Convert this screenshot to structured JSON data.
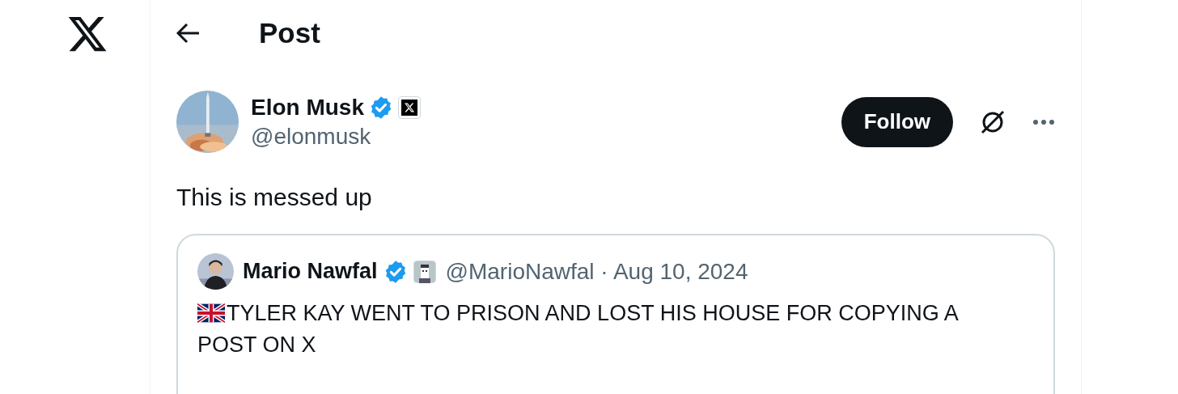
{
  "header": {
    "title": "Post"
  },
  "post": {
    "author": {
      "name": "Elon Musk",
      "handle": "@elonmusk",
      "verified": true,
      "affiliate": true
    },
    "follow_button": "Follow",
    "text": "This is messed up",
    "quote": {
      "author": {
        "name": "Mario Nawfal",
        "handle_and_date": "@MarioNawfal · Aug 10, 2024",
        "verified": true,
        "affiliate": true
      },
      "flag": true,
      "text": "TYLER KAY WENT TO PRISON AND LOST HIS HOUSE FOR COPYING A POST ON X"
    }
  }
}
